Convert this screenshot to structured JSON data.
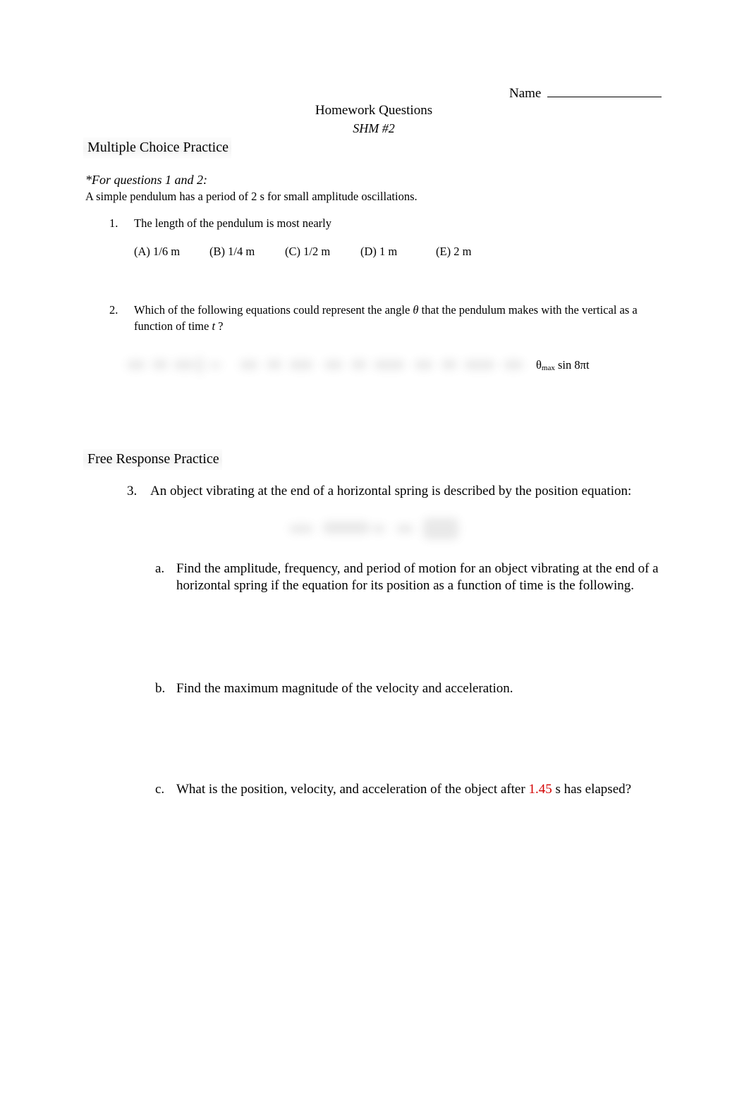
{
  "header": {
    "name_label": "Name",
    "title": "Homework Questions",
    "subtitle": "SHM #2"
  },
  "sections": {
    "multiple_choice_heading": "Multiple Choice Practice",
    "free_response_heading": "Free Response Practice"
  },
  "intro": {
    "italic_line": "*For questions 1 and 2:",
    "plain_line": "A simple pendulum has a period of 2 s for small amplitude oscillations."
  },
  "question1": {
    "number": "1.",
    "text": "The length of the pendulum is most nearly",
    "choices": [
      "(A) 1/6 m",
      "(B) 1/4 m",
      "(C) 1/2 m",
      "(D) 1 m",
      "(E) 2 m"
    ]
  },
  "question2": {
    "number": "2.",
    "text_part1": "Which of the following equations could represent the angle ",
    "theta_symbol": "θ",
    "text_part2": " that the pendulum makes with the vertical as a function of time ",
    "t_symbol": "t",
    "text_part3": " ?",
    "choice_e_visible": "θmax sin 8πt",
    "choice_e_prefix": "θ",
    "choice_e_sub": "max",
    "choice_e_suffix": " sin 8πt",
    "blurred_choices_note": "(A)-(D) equations are blurred and illegible"
  },
  "question3": {
    "number": "3.",
    "text": "An object vibrating at the end of a horizontal spring is described by the position equation:",
    "equation_note": "(position equation is blurred and illegible)",
    "parts": [
      {
        "letter": "a.",
        "text": "Find the amplitude, frequency, and period of motion for an object vibrating at the end of a horizontal spring if the equation for its position as a function of time is the following."
      },
      {
        "letter": "b.",
        "text": "Find the maximum magnitude of the velocity and acceleration."
      },
      {
        "letter": "c.",
        "text_before": "What is the position, velocity, and acceleration of the object after ",
        "highlight_value": "1.45",
        "text_after": " s has elapsed?"
      }
    ]
  },
  "colors": {
    "text": "#000000",
    "highlight_red": "#d40000",
    "page_background": "#ffffff",
    "heading_shade": "rgba(0,0,0,0.045)"
  }
}
